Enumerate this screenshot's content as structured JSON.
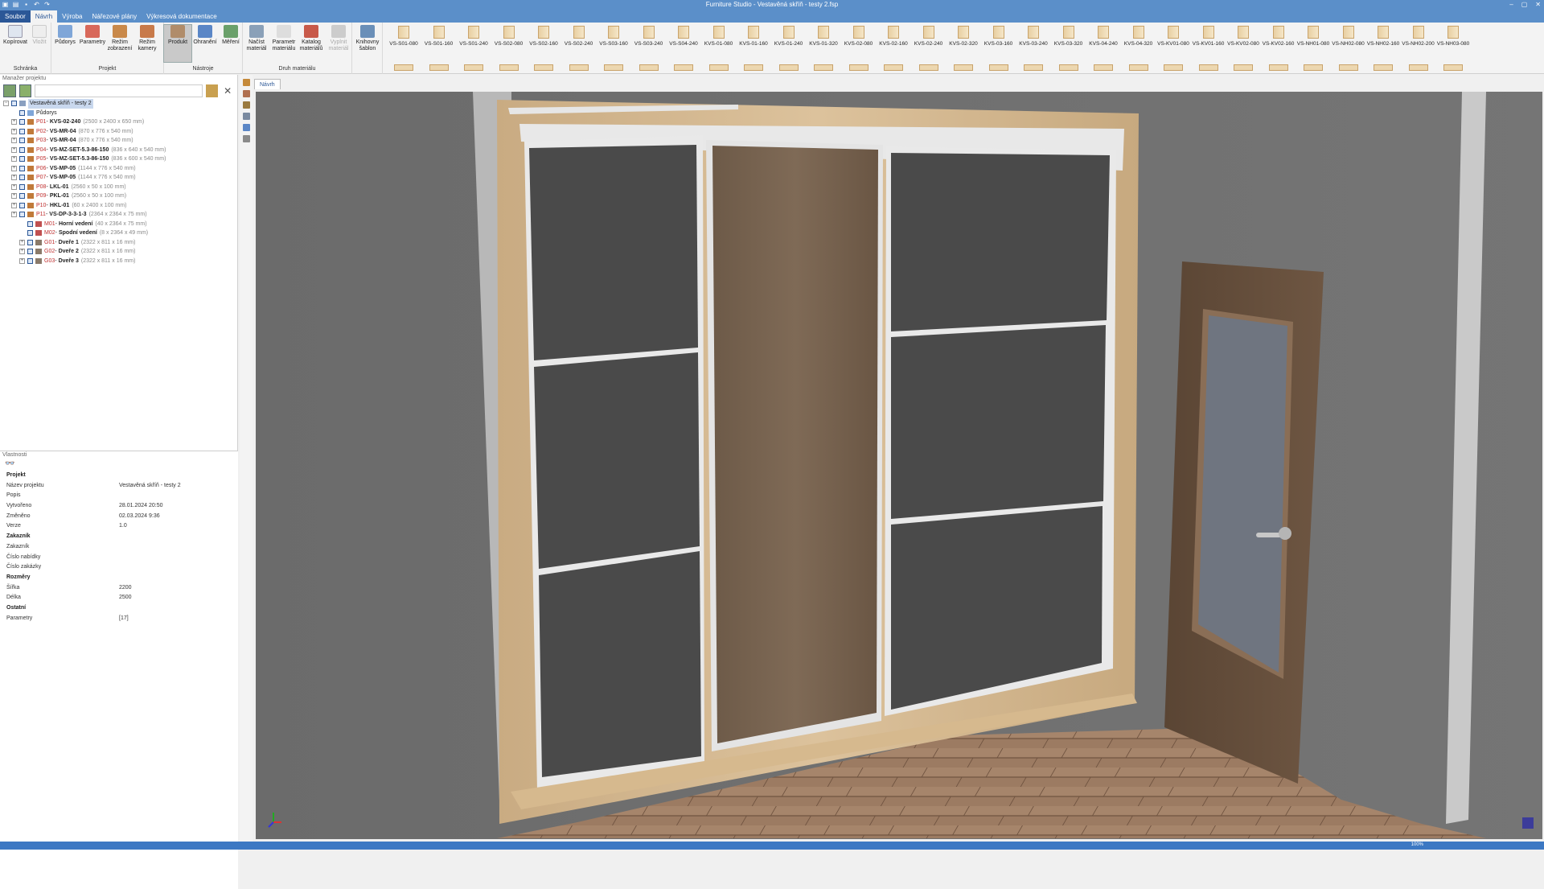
{
  "app": {
    "title": "Furniture Studio - Vestavěná skříň - testy 2.fsp"
  },
  "menu": [
    "Soubor",
    "Návrh",
    "Výroba",
    "Nářezové plány",
    "Výkresová dokumentace"
  ],
  "ribbon": {
    "groups": {
      "clipboard": {
        "label": "Schránka",
        "buttons": [
          "Kopírovat",
          "Vložit"
        ]
      },
      "project": {
        "label": "Projekt",
        "buttons": [
          "Půdorys",
          "Parametry",
          "Režim zobrazení",
          "Režim kamery"
        ]
      },
      "tools": {
        "label": "Nástroje",
        "buttons": [
          "Produkt",
          "Ohranění",
          "Měření"
        ]
      },
      "material": {
        "label": "Druh materiálu",
        "buttons": [
          "Načíst materiál",
          "Parametr materiálu",
          "Katalog materiálů",
          "Vyplnit materiál"
        ]
      },
      "library": {
        "buttons": [
          "Knihovny šablon"
        ]
      }
    },
    "catalog": [
      "VS-S01-080",
      "VS-S01-160",
      "VS-S01-240",
      "VS-S02-080",
      "VS-S02-160",
      "VS-S02-240",
      "VS-S03-160",
      "VS-S03-240",
      "VS-S04-240",
      "KVS-01-080",
      "KVS-01-160",
      "KVS-01-240",
      "KVS-01-320",
      "KVS-02-080",
      "KVS-02-160",
      "KVS-02-240",
      "KVS-02-320",
      "KVS-03-160",
      "KVS-03-240",
      "KVS-03-320",
      "KVS-04-240",
      "KVS-04-320",
      "VS-KV01-080",
      "VS-KV01-160",
      "VS-KV02-080",
      "VS-KV02-160",
      "VS-NH01-080",
      "VS-NH02-080",
      "VS-NH02-160",
      "VS-NH02-200",
      "VS-NH03-080"
    ]
  },
  "project_manager": {
    "title": "Manažer projektu",
    "root": "Vestavěná skříň - testy 2",
    "items": [
      {
        "code": "",
        "name": "Půdorys",
        "dims": ""
      },
      {
        "code": "P01",
        "name": "KVS-02-240",
        "dims": "(2500 x 2400 x 650 mm)"
      },
      {
        "code": "P02",
        "name": "VS-MR-04",
        "dims": "(870 x 776 x 540 mm)"
      },
      {
        "code": "P03",
        "name": "VS-MR-04",
        "dims": "(870 x 776 x 540 mm)"
      },
      {
        "code": "P04",
        "name": "VS-MZ-SET-5.3-86-150",
        "dims": "(836 x 640 x 540 mm)"
      },
      {
        "code": "P05",
        "name": "VS-MZ-SET-5.3-86-150",
        "dims": "(836 x 600 x 540 mm)"
      },
      {
        "code": "P06",
        "name": "VS-MP-05",
        "dims": "(1144 x 776 x 540 mm)"
      },
      {
        "code": "P07",
        "name": "VS-MP-05",
        "dims": "(1144 x 776 x 540 mm)"
      },
      {
        "code": "P08",
        "name": "LKL-01",
        "dims": "(2560 x 50 x 100 mm)"
      },
      {
        "code": "P09",
        "name": "PKL-01",
        "dims": "(2560 x 50 x 100 mm)"
      },
      {
        "code": "P10",
        "name": "HKL-01",
        "dims": "(60 x 2400 x 100 mm)"
      },
      {
        "code": "P11",
        "name": "VS-DP-3-3-1-3",
        "dims": "(2364 x 2364 x 75 mm)"
      },
      {
        "code": "M01",
        "name": "Horní vedení",
        "dims": "(40 x 2364 x 75 mm)"
      },
      {
        "code": "M02",
        "name": "Spodní vedení",
        "dims": "(8 x 2364 x 49 mm)"
      },
      {
        "code": "G01",
        "name": "Dveře 1",
        "dims": "(2322 x 811 x 16 mm)"
      },
      {
        "code": "G02",
        "name": "Dveře 2",
        "dims": "(2322 x 811 x 16 mm)"
      },
      {
        "code": "G03",
        "name": "Dveře 3",
        "dims": "(2322 x 811 x 16 mm)"
      }
    ]
  },
  "properties": {
    "title": "Vlastnosti",
    "sections": [
      {
        "header": "Projekt",
        "rows": [
          {
            "k": "Název projektu",
            "v": "Vestavěná skříň - testy 2"
          },
          {
            "k": "Popis",
            "v": ""
          },
          {
            "k": "Vytvořeno",
            "v": "28.01.2024 20:50"
          },
          {
            "k": "Změněno",
            "v": "02.03.2024 9:36"
          },
          {
            "k": "Verze",
            "v": "1.0"
          }
        ]
      },
      {
        "header": "Zakazník",
        "rows": [
          {
            "k": "Zakazník",
            "v": ""
          },
          {
            "k": "Číslo nabídky",
            "v": ""
          },
          {
            "k": "Číslo zakázky",
            "v": ""
          }
        ]
      },
      {
        "header": "Rozměry",
        "rows": [
          {
            "k": "Šířka",
            "v": "2200"
          },
          {
            "k": "Délka",
            "v": "2500"
          }
        ]
      },
      {
        "header": "Ostatní",
        "rows": [
          {
            "k": "Parametry",
            "v": "[17]"
          }
        ]
      }
    ]
  },
  "view": {
    "tab": "Návrh"
  },
  "status": {
    "zoom": "100%"
  },
  "colors": {
    "accent": "#5b8fc9",
    "wood": "#d6b98e",
    "glass_dark": "#4b4b4b",
    "floor": "#a07f66"
  }
}
